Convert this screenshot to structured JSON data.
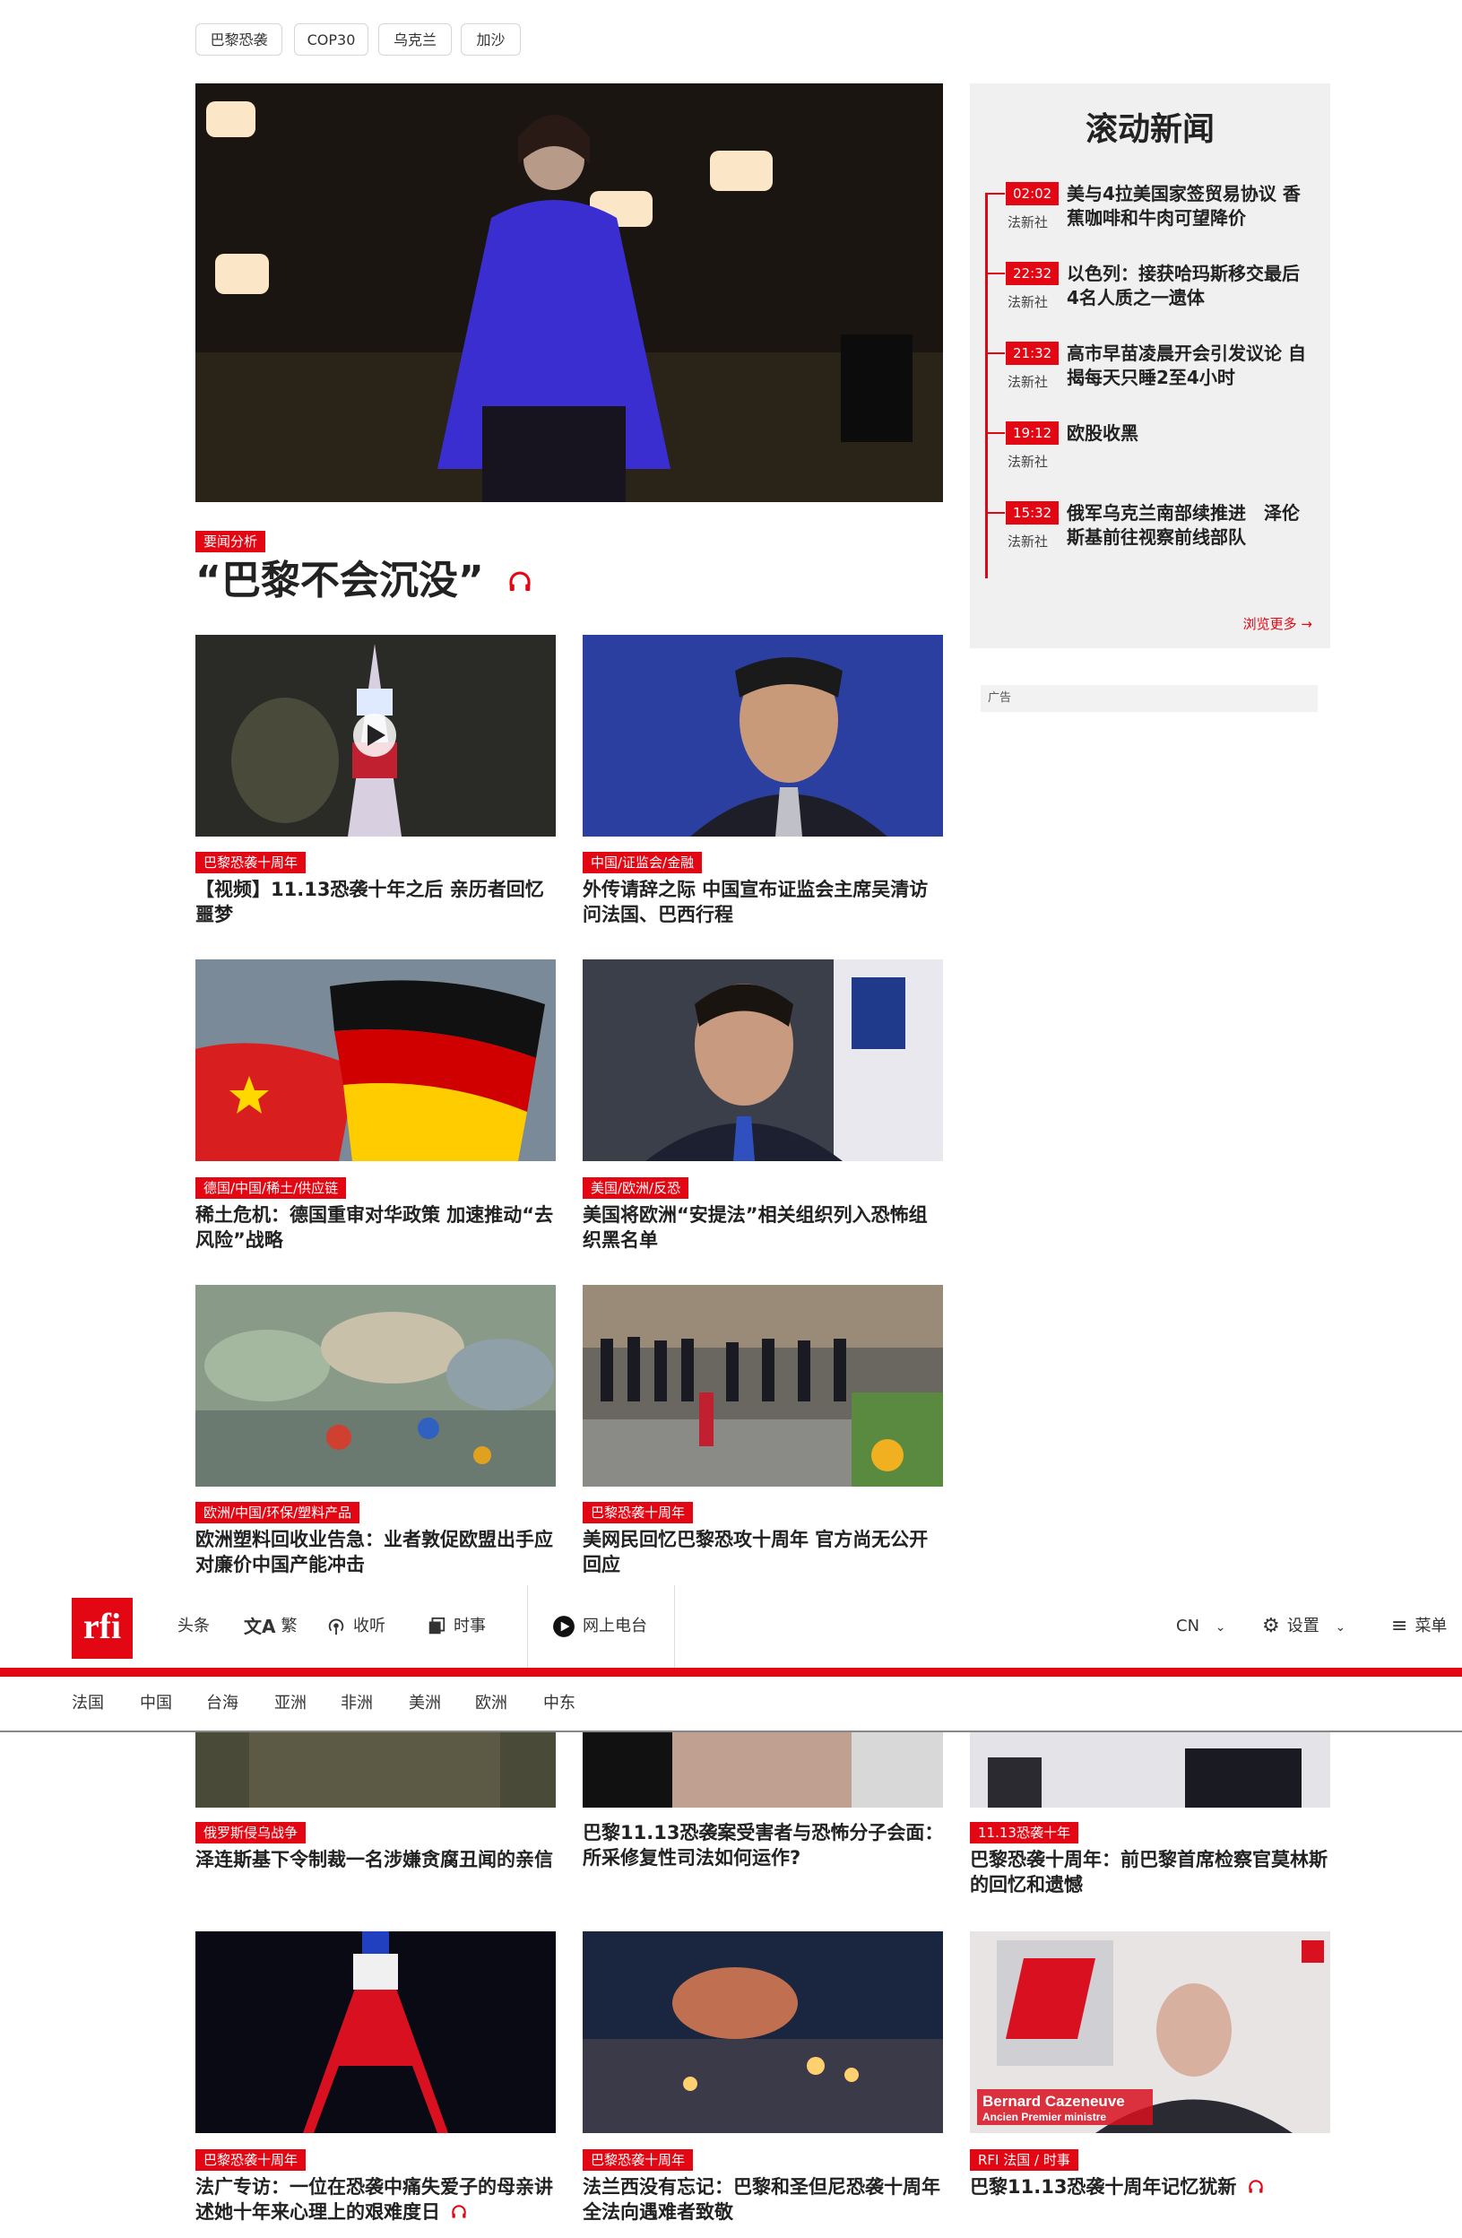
{
  "topic_tags": [
    "巴黎恐袭",
    "COP30",
    "乌克兰",
    "加沙"
  ],
  "hero": {
    "label": "要闻分析",
    "title": "“巴黎不会沉没”"
  },
  "articles": [
    {
      "label": "巴黎恐袭十周年",
      "title": "【视频】11.13恐袭十年之后 亲历者回忆噩梦"
    },
    {
      "label": "中国/证监会/金融",
      "title": "外传请辞之际 中国宣布证监会主席吴清访问法国、巴西行程"
    },
    {
      "label": "德国/中国/稀土/供应链",
      "title": "稀土危机：德国重审对华政策 加速推动“去风险”战略"
    },
    {
      "label": "美国/欧洲/反恐",
      "title": "美国将欧洲“安提法”相关组织列入恐怖组织黑名单"
    },
    {
      "label": "欧洲/中国/环保/塑料产品",
      "title": "欧洲塑料回收业告急：业者敦促欧盟出手应对廉价中国产能冲击"
    },
    {
      "label": "巴黎恐袭十周年",
      "title": "美网民回忆巴黎恐攻十周年 官方尚无公开回应"
    }
  ],
  "lower_articles": [
    {
      "label": "俄罗斯侵乌战争",
      "title": "泽连斯基下令制裁一名涉嫌贪腐丑闻的亲信"
    },
    {
      "label": "",
      "title": "巴黎11.13恐袭案受害者与恐怖分子会面：所采修复性司法如何运作?"
    },
    {
      "label": "11.13恐袭十年",
      "title": "巴黎恐袭十周年：前巴黎首席检察官莫林斯的回忆和遗憾"
    },
    {
      "label": "巴黎恐袭十周年",
      "title": "法广专访：一位在恐袭中痛失爱子的母亲讲述她十年来心理上的艰难度日"
    },
    {
      "label": "巴黎恐袭十周年",
      "title": "法兰西没有忘记：巴黎和圣但尼恐袭十周年 全法向遇难者致敬"
    },
    {
      "label": "RFI 法国 / 时事",
      "title": "巴黎11.13恐袭十周年记忆犹新"
    }
  ],
  "sidebar": {
    "title": "滚动新闻",
    "items": [
      {
        "time": "02:02",
        "source": "法新社",
        "title": "美与4拉美国家签贸易协议 香蕉咖啡和牛肉可望降价"
      },
      {
        "time": "22:32",
        "source": "法新社",
        "title": "以色列：接获哈玛斯移交最后4名人质之一遗体"
      },
      {
        "time": "21:32",
        "source": "法新社",
        "title": "高市早苗凌晨开会引发议论 自揭每天只睡2至4小时"
      },
      {
        "time": "19:12",
        "source": "法新社",
        "title": "欧股收黑"
      },
      {
        "time": "15:32",
        "source": "法新社",
        "title": "俄军乌克兰南部续推进　泽伦斯基前往视察前线部队"
      }
    ],
    "more": "浏览更多 →"
  },
  "ad_label": "广告",
  "image_caption": {
    "name": "Bernard Cazeneuve",
    "role": "Ancien Premier ministre"
  },
  "navbar": {
    "logo": "rfi",
    "items": [
      "头条",
      "繁",
      "收听",
      "时事",
      "网上电台"
    ],
    "lang": "CN",
    "settings": "设置",
    "menu": "菜单"
  },
  "subnav": [
    "法国",
    "中国",
    "台海",
    "亚洲",
    "非洲",
    "美洲",
    "欧洲",
    "中东"
  ],
  "colors": {
    "brand_red": "#e30613"
  }
}
